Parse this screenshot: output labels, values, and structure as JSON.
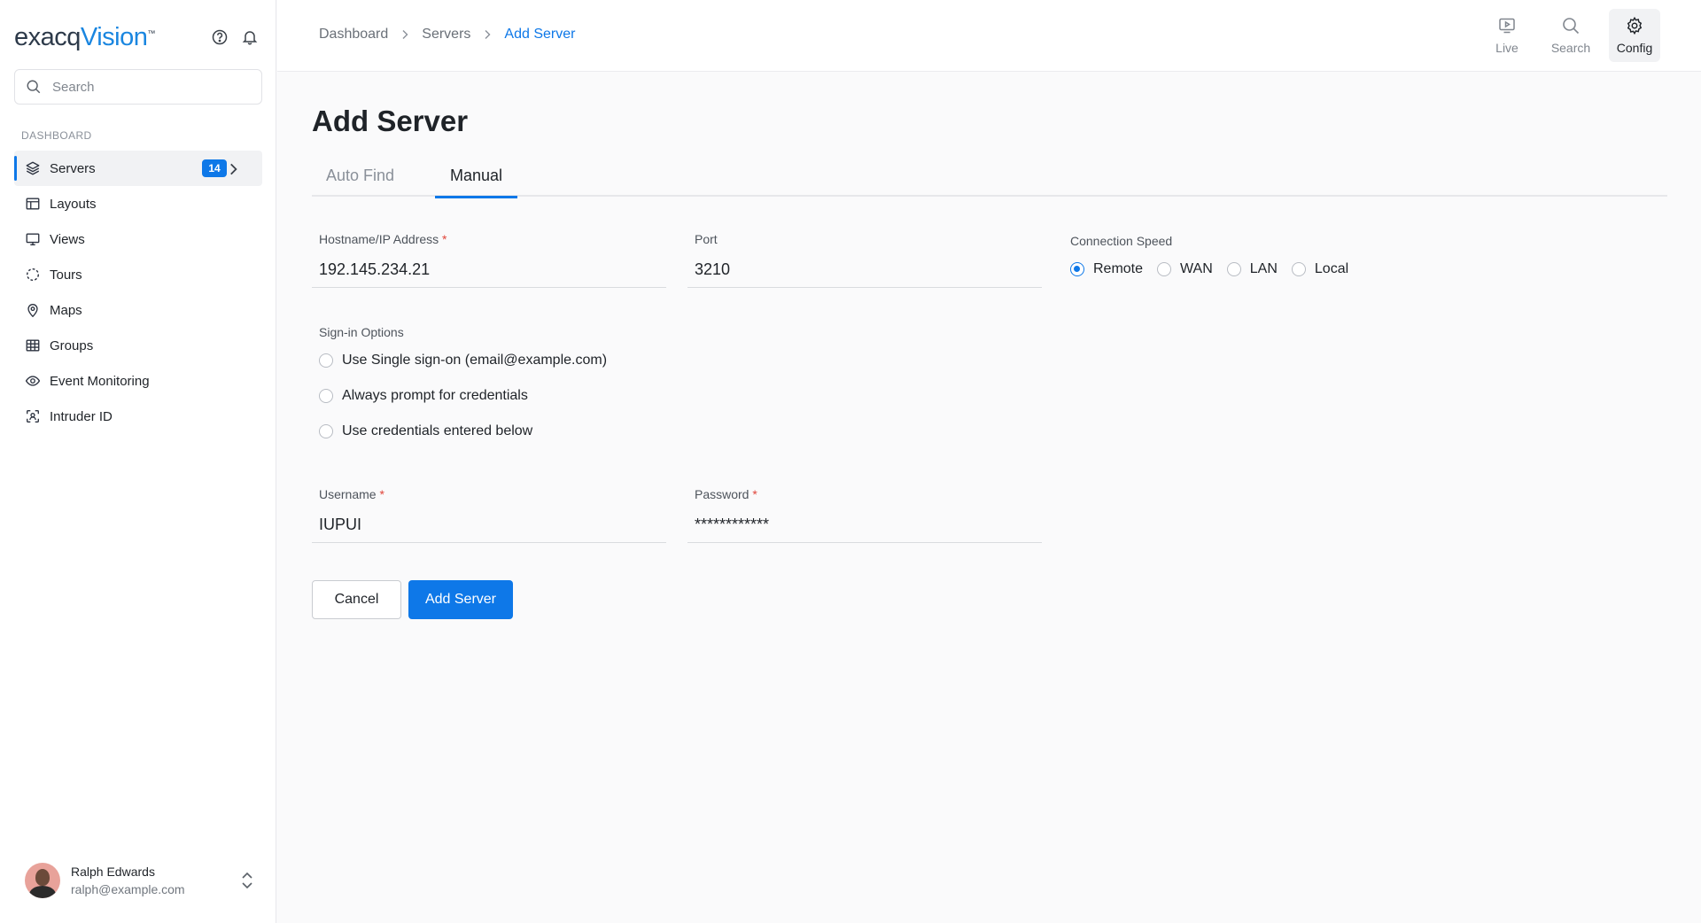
{
  "app": {
    "logo_prefix": "exacq",
    "logo_suffix": "Vision",
    "logo_mark": "™"
  },
  "sidebar": {
    "search_placeholder": "Search",
    "section_label": "DASHBOARD",
    "items": [
      {
        "label": "Servers",
        "icon": "layers-icon",
        "badge": "14",
        "active": true
      },
      {
        "label": "Layouts",
        "icon": "layout-icon"
      },
      {
        "label": "Views",
        "icon": "monitor-icon"
      },
      {
        "label": "Tours",
        "icon": "dashed-circle-icon"
      },
      {
        "label": "Maps",
        "icon": "map-pin-icon"
      },
      {
        "label": "Groups",
        "icon": "grid-table-icon"
      },
      {
        "label": "Event Monitoring",
        "icon": "eye-icon"
      },
      {
        "label": "Intruder ID",
        "icon": "face-scan-icon"
      }
    ],
    "user": {
      "name": "Ralph Edwards",
      "email": "ralph@example.com"
    }
  },
  "breadcrumb": [
    "Dashboard",
    "Servers",
    "Add Server"
  ],
  "toolbar": {
    "live": "Live",
    "search": "Search",
    "config": "Config"
  },
  "page": {
    "title": "Add Server",
    "tabs": [
      "Auto Find",
      "Manual"
    ],
    "active_tab": "Manual",
    "hostname": {
      "label": "Hostname/IP Address",
      "required_mark": "*",
      "value": "192.145.234.21"
    },
    "port": {
      "label": "Port",
      "value": "3210"
    },
    "connection_speed": {
      "label": "Connection Speed",
      "options": [
        "Remote",
        "WAN",
        "LAN",
        "Local"
      ],
      "selected": "Remote"
    },
    "signin": {
      "label": "Sign-in Options",
      "options": [
        "Use Single sign-on (email@example.com)",
        "Always prompt for credentials",
        "Use credentials entered below"
      ]
    },
    "username": {
      "label": "Username",
      "required_mark": "*",
      "value": "IUPUI"
    },
    "password": {
      "label": "Password",
      "required_mark": "*",
      "value": "************"
    },
    "cancel_label": "Cancel",
    "submit_label": "Add Server"
  },
  "colors": {
    "accent": "#0e78e8",
    "required": "#e0453a"
  }
}
